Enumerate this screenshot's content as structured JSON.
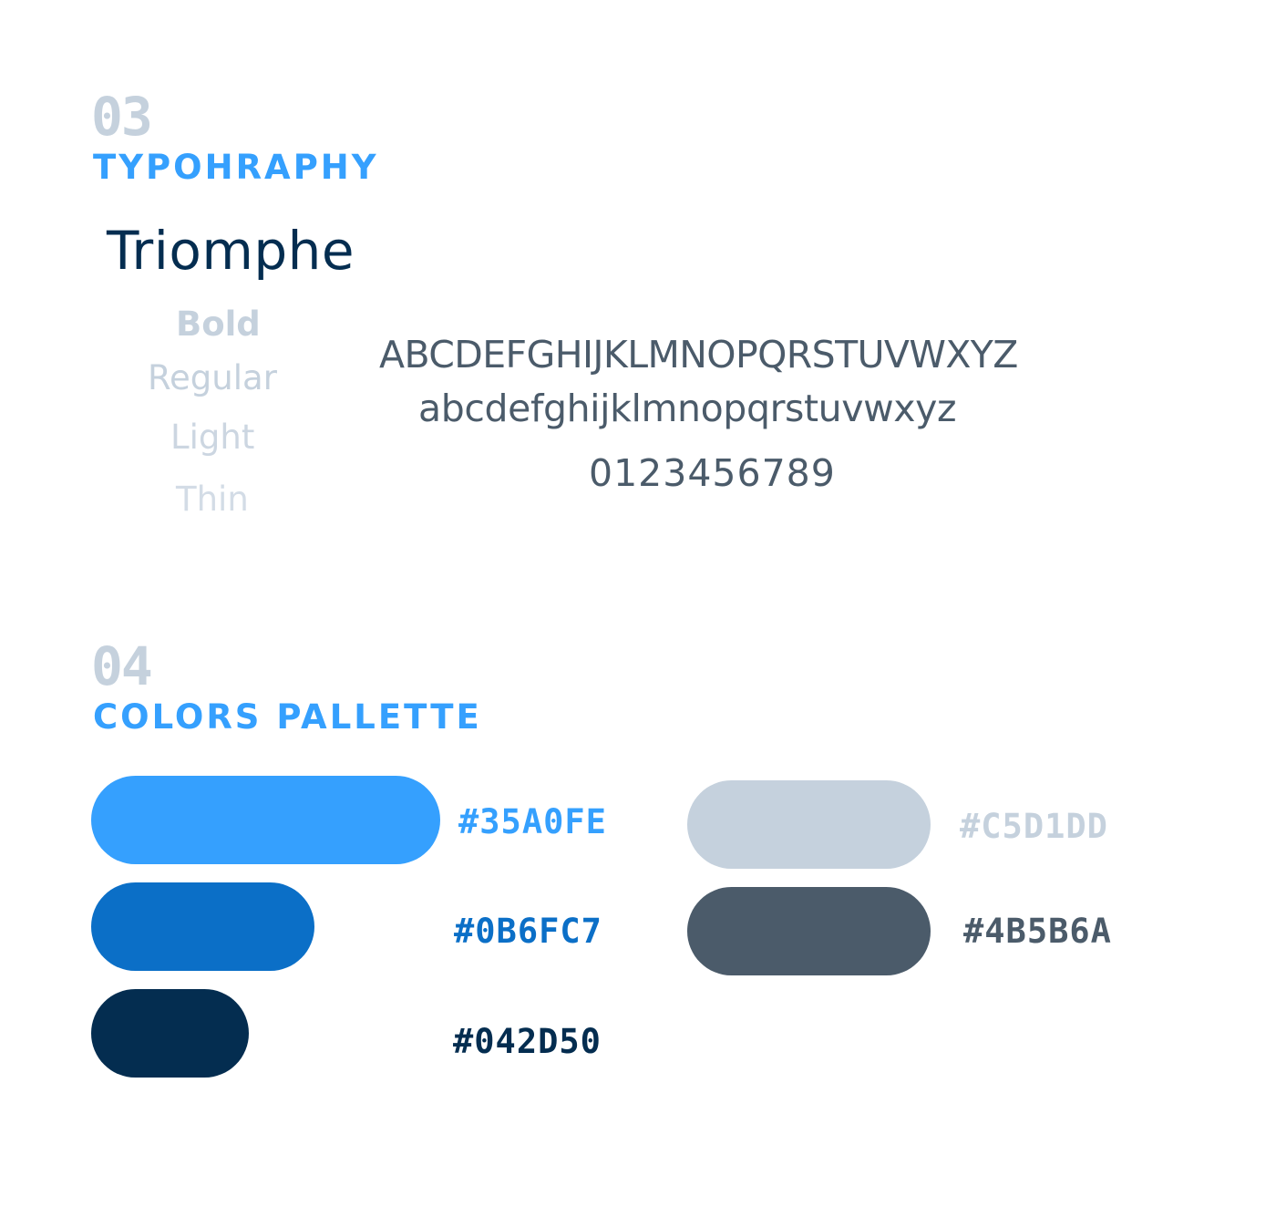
{
  "typography": {
    "number": "03",
    "title": "TYPOHRAPHY",
    "font_name": "Triomphe",
    "weights": [
      "Bold",
      "Regular",
      "Light",
      "Thin"
    ],
    "uppercase": "ABCDEFGHIJKLMNOPQRSTUVWXYZ",
    "lowercase": "abcdefghijklmnopqrstuvwxyz",
    "digits": "0123456789"
  },
  "colors": {
    "number": "04",
    "title": "COLORS PALLETTE",
    "swatches": [
      {
        "hex": "#35A0FE",
        "color": "#35A0FE"
      },
      {
        "hex": "#0B6FC7",
        "color": "#0B6FC7"
      },
      {
        "hex": "#042D50",
        "color": "#042D50"
      },
      {
        "hex": "#C5D1DD",
        "color": "#C5D1DD"
      },
      {
        "hex": "#4B5B6A",
        "color": "#4B5B6A"
      }
    ]
  }
}
